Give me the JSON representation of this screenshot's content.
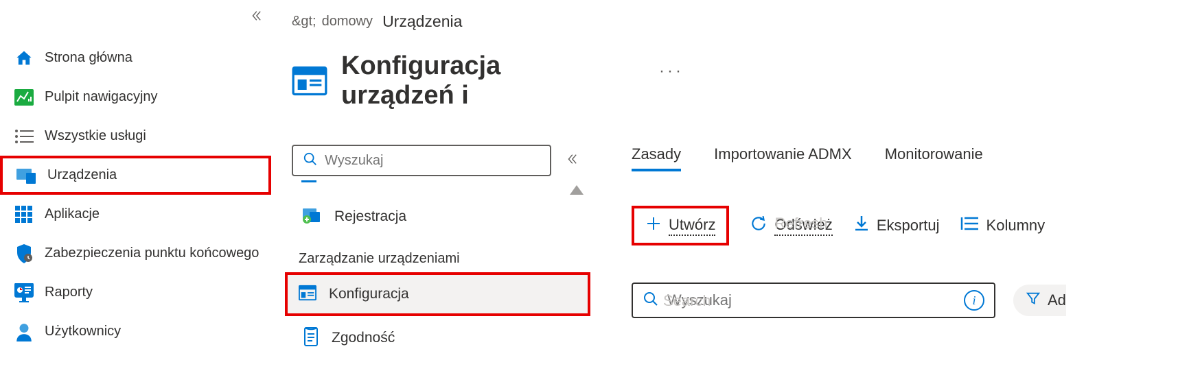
{
  "sidebar": {
    "items": [
      {
        "label": "Strona główna",
        "icon": "home"
      },
      {
        "label": "Pulpit nawigacyjny",
        "icon": "dashboard"
      },
      {
        "label": "Wszystkie usługi",
        "icon": "list"
      },
      {
        "label": "Urządzenia",
        "icon": "devices"
      },
      {
        "label": "Aplikacje",
        "icon": "apps"
      },
      {
        "label": "Zabezpieczenia punktu końcowego",
        "icon": "shield"
      },
      {
        "label": "Raporty",
        "icon": "reports"
      },
      {
        "label": "Użytkownicy",
        "icon": "user"
      }
    ]
  },
  "breadcrumb": {
    "prefix": "&gt;",
    "item1": "domowy",
    "item2": "Urządzenia"
  },
  "page": {
    "title": "Konfiguracja urządzeń i",
    "ellipsis": "···"
  },
  "subnav": {
    "search_placeholder": "Wyszukaj",
    "item_rejestracja": "Rejestracja",
    "section_label": "Zarządzanie urządzeniami",
    "item_konfiguracja": "Konfiguracja",
    "item_zgodnosc": "Zgodność"
  },
  "tabs": {
    "zasady": "Zasady",
    "admx": "Importowanie ADMX",
    "monitor": "Monitorowanie"
  },
  "toolbar": {
    "create": "Utwórz",
    "refresh": "Odśwież",
    "refresh_under": "Refresh",
    "export": "Eksportuj",
    "columns": "Kolumny"
  },
  "main_search": {
    "placeholder": "Wyszukaj",
    "under": "Search"
  },
  "filter": {
    "label": "Ad"
  }
}
